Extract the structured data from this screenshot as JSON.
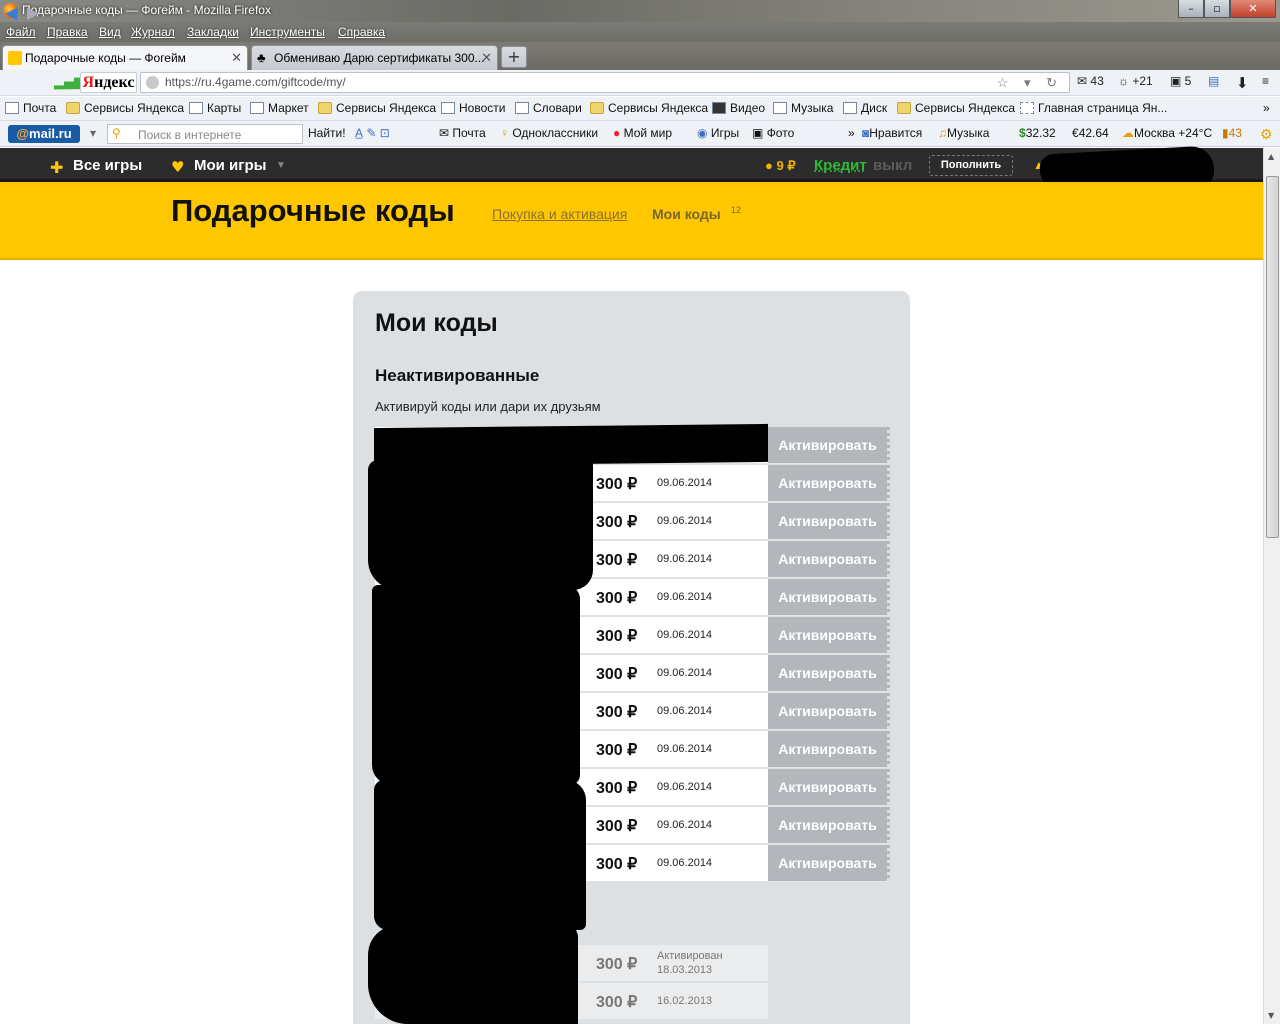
{
  "window": {
    "title": "Подарочные коды — Фогейм - Mozilla Firefox"
  },
  "menu": [
    "Файл",
    "Правка",
    "Вид",
    "Журнал",
    "Закладки",
    "Инструменты",
    "Справка"
  ],
  "tabs": [
    {
      "label": "Подарочные коды — Фогейм",
      "active": true
    },
    {
      "label": "Обмениваю Дарю сертификаты 300...",
      "active": false
    }
  ],
  "nav": {
    "url": "https://ru.4game.com/giftcode/my/",
    "mail_count": "43",
    "weather_delta": "+21",
    "counter": "5",
    "yandex_logo": "Яндекс"
  },
  "bookmarks": [
    "Почта",
    "Сервисы Яндекса",
    "Карты",
    "Маркет",
    "Сервисы Яндекса",
    "Новости",
    "Словари",
    "Сервисы Яндекса",
    "Видео",
    "Музыка",
    "Диск",
    "Сервисы Яндекса",
    "Главная страница Ян..."
  ],
  "mailbar": {
    "logo": "@mail.ru",
    "search_placeholder": "Поиск в интернете",
    "find": "Найти!",
    "items": [
      "Почта",
      "Одноклассники",
      "Мой мир",
      "Игры",
      "Фото",
      "Нравится",
      "Музыка"
    ],
    "usd": "32.32",
    "eur": "42.64",
    "weather": "Москва +24°C",
    "msgs": "43"
  },
  "site": {
    "all_games": "Все игры",
    "my_games": "Мои игры",
    "balance": "9 ₽",
    "credit": "Кредит",
    "credit_state": "выкл",
    "refill": "Пополнить",
    "accent": "#ffc700"
  },
  "header": {
    "title": "Подарочные коды",
    "link_buy": "Покупка и активация",
    "link_my": "Мои коды",
    "my_count": "12"
  },
  "panel": {
    "title": "Мои коды",
    "section": "Неактивированные",
    "description": "Активируй коды или дари их друзьям",
    "activate_label": "Активировать",
    "unactivated": [
      {
        "amount": "",
        "date": ""
      },
      {
        "amount": "300 ₽",
        "date": "09.06.2014"
      },
      {
        "amount": "300 ₽",
        "date": "09.06.2014"
      },
      {
        "amount": "300 ₽",
        "date": "09.06.2014"
      },
      {
        "amount": "300 ₽",
        "date": "09.06.2014"
      },
      {
        "amount": "300 ₽",
        "date": "09.06.2014"
      },
      {
        "amount": "300 ₽",
        "date": "09.06.2014"
      },
      {
        "amount": "300 ₽",
        "date": "09.06.2014"
      },
      {
        "amount": "300 ₽",
        "date": "09.06.2014"
      },
      {
        "amount": "300 ₽",
        "date": "09.06.2014"
      },
      {
        "amount": "300 ₽",
        "date": "09.06.2014"
      },
      {
        "amount": "300 ₽",
        "date": "09.06.2014"
      }
    ],
    "activated": [
      {
        "amount": "300 ₽",
        "status": "Активирован",
        "date": "18.03.2013"
      },
      {
        "amount": "300 ₽",
        "status": "",
        "date": "16.02.2013"
      }
    ]
  }
}
